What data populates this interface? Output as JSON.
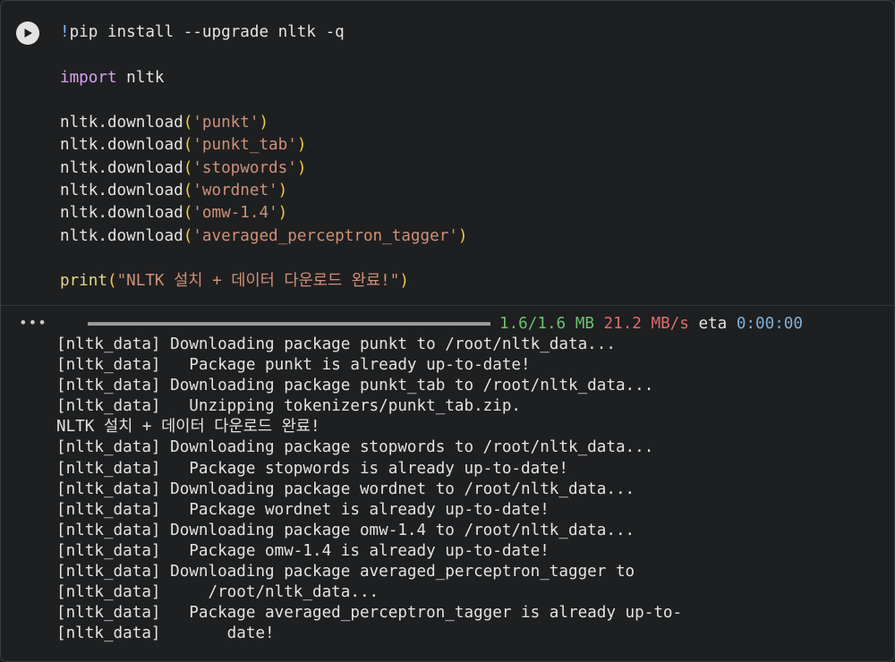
{
  "code_lines": [
    [
      {
        "t": "!",
        "c": "bang"
      },
      {
        "t": "pip install --upgrade nltk -q",
        "c": ""
      }
    ],
    [],
    [
      {
        "t": "import",
        "c": "kw"
      },
      {
        "t": " nltk",
        "c": ""
      }
    ],
    [],
    [
      {
        "t": "nltk.download",
        "c": ""
      },
      {
        "t": "(",
        "c": "paren"
      },
      {
        "t": "'punkt'",
        "c": "str"
      },
      {
        "t": ")",
        "c": "paren"
      }
    ],
    [
      {
        "t": "nltk.download",
        "c": ""
      },
      {
        "t": "(",
        "c": "paren"
      },
      {
        "t": "'punkt_tab'",
        "c": "str"
      },
      {
        "t": ")",
        "c": "paren"
      }
    ],
    [
      {
        "t": "nltk.download",
        "c": ""
      },
      {
        "t": "(",
        "c": "paren"
      },
      {
        "t": "'stopwords'",
        "c": "str"
      },
      {
        "t": ")",
        "c": "paren"
      }
    ],
    [
      {
        "t": "nltk.download",
        "c": ""
      },
      {
        "t": "(",
        "c": "paren"
      },
      {
        "t": "'wordnet'",
        "c": "str"
      },
      {
        "t": ")",
        "c": "paren"
      }
    ],
    [
      {
        "t": "nltk.download",
        "c": ""
      },
      {
        "t": "(",
        "c": "paren"
      },
      {
        "t": "'omw-1.4'",
        "c": "str"
      },
      {
        "t": ")",
        "c": "paren"
      }
    ],
    [
      {
        "t": "nltk.download",
        "c": ""
      },
      {
        "t": "(",
        "c": "paren"
      },
      {
        "t": "'averaged_perceptron_tagger'",
        "c": "str"
      },
      {
        "t": ")",
        "c": "paren"
      }
    ],
    [],
    [
      {
        "t": "print",
        "c": "fn"
      },
      {
        "t": "(",
        "c": "paren"
      },
      {
        "t": "\"NLTK 설치 + 데이터 다운로드 완료!\"",
        "c": "str"
      },
      {
        "t": ")",
        "c": "paren"
      }
    ]
  ],
  "output_icon": "•••",
  "progress": {
    "fraction": 1.0,
    "size": "1.6/1.6 MB",
    "rate": "21.2 MB/s",
    "eta_label": "eta",
    "eta": "0:00:00"
  },
  "output_lines": [
    "[nltk_data] Downloading package punkt to /root/nltk_data...",
    "[nltk_data]   Package punkt is already up-to-date!",
    "[nltk_data] Downloading package punkt_tab to /root/nltk_data...",
    "[nltk_data]   Unzipping tokenizers/punkt_tab.zip.",
    "NLTK 설치 + 데이터 다운로드 완료!",
    "[nltk_data] Downloading package stopwords to /root/nltk_data...",
    "[nltk_data]   Package stopwords is already up-to-date!",
    "[nltk_data] Downloading package wordnet to /root/nltk_data...",
    "[nltk_data]   Package wordnet is already up-to-date!",
    "[nltk_data] Downloading package omw-1.4 to /root/nltk_data...",
    "[nltk_data]   Package omw-1.4 is already up-to-date!",
    "[nltk_data] Downloading package averaged_perceptron_tagger to",
    "[nltk_data]     /root/nltk_data...",
    "[nltk_data]   Package averaged_perceptron_tagger is already up-to-",
    "[nltk_data]       date!"
  ],
  "colors": {
    "background": "#1e1f20",
    "keyword": "#d7a0f2",
    "string": "#ce9178",
    "paren": "#f2c94c",
    "progress_size": "#6cc070",
    "progress_rate": "#e06c6c",
    "progress_eta": "#7fb0d8"
  }
}
